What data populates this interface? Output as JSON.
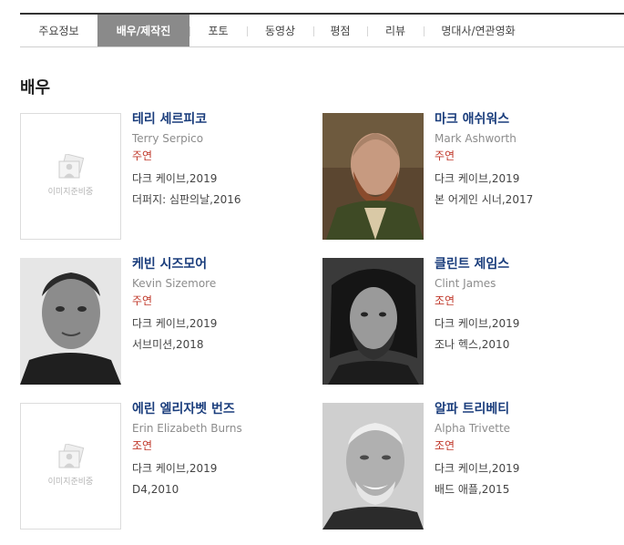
{
  "tabs": [
    {
      "label": "주요정보",
      "active": false
    },
    {
      "label": "배우/제작진",
      "active": true
    },
    {
      "label": "포토",
      "active": false
    },
    {
      "label": "동영상",
      "active": false
    },
    {
      "label": "평점",
      "active": false
    },
    {
      "label": "리뷰",
      "active": false
    },
    {
      "label": "명대사/연관영화",
      "active": false
    }
  ],
  "section_title": "배우",
  "placeholder_text": "이미지준비중",
  "actors": [
    {
      "name": "테리 세르피코",
      "eng": "Terry Serpico",
      "role": "주연",
      "works": [
        "다크 케이브,2019",
        "더퍼지: 심판의날,2016"
      ],
      "photo": "placeholder"
    },
    {
      "name": "마크 애쉬워스",
      "eng": "Mark Ashworth",
      "role": "주연",
      "works": [
        "다크 케이브,2019",
        "본 어게인 시너,2017"
      ],
      "photo": "portrait"
    },
    {
      "name": "케빈 시즈모어",
      "eng": "Kevin Sizemore",
      "role": "주연",
      "works": [
        "다크 케이브,2019",
        "서브미션,2018"
      ],
      "photo": "portrait"
    },
    {
      "name": "클린트 제임스",
      "eng": "Clint James",
      "role": "조연",
      "works": [
        "다크 케이브,2019",
        "조나 헥스,2010"
      ],
      "photo": "portrait"
    },
    {
      "name": "에린 엘리자벳 번즈",
      "eng": "Erin Elizabeth Burns",
      "role": "조연",
      "works": [
        "다크 케이브,2019",
        "D4,2010"
      ],
      "photo": "placeholder"
    },
    {
      "name": "알파 트리베티",
      "eng": "Alpha Trivette",
      "role": "조연",
      "works": [
        "다크 케이브,2019",
        "배드 애플,2015"
      ],
      "photo": "portrait"
    }
  ]
}
